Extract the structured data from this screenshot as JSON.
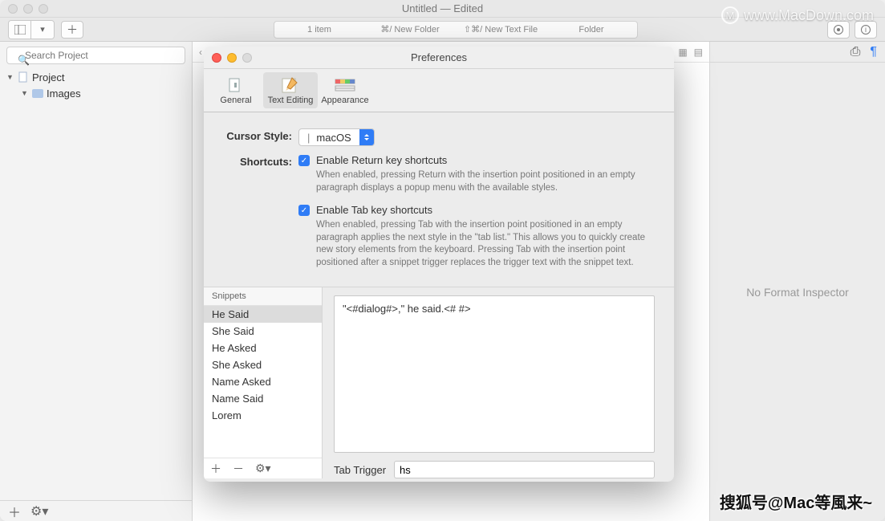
{
  "window": {
    "title": "Untitled — Edited",
    "infobar": {
      "items": "1 item",
      "newFolder": "⌘/ New Folder",
      "newTextFile": "⇧⌘/ New Text File",
      "folder": "Folder"
    }
  },
  "search": {
    "placeholder": "Search Project"
  },
  "tree": {
    "root": "Project",
    "child": "Images"
  },
  "inspector": {
    "empty": "No Format Inspector"
  },
  "prefs": {
    "title": "Preferences",
    "tabs": {
      "general": "General",
      "text": "Text Editing",
      "appearance": "Appearance"
    },
    "cursor": {
      "label": "Cursor Style:",
      "value": "macOS"
    },
    "shortcuts": {
      "label": "Shortcuts:",
      "return_label": "Enable Return key shortcuts",
      "return_help": "When enabled, pressing Return with the insertion point positioned in an empty paragraph displays a popup menu with the available styles.",
      "tab_label": "Enable Tab key shortcuts",
      "tab_help": "When enabled, pressing Tab with the insertion point positioned in an empty paragraph applies the next style in the \"tab list.\" This allows you to quickly create new story elements from the keyboard. Pressing Tab with the insertion point positioned after a snippet trigger replaces the trigger text with the snippet text."
    },
    "snippets": {
      "header": "Snippets",
      "items": [
        "He Said",
        "She Said",
        "He Asked",
        "She Asked",
        "Name Asked",
        "Name Said",
        "Lorem"
      ],
      "text": "\"<#dialog#>,\" he said.<# #>",
      "trigger_label": "Tab Trigger",
      "trigger_value": "hs"
    }
  },
  "watermark": {
    "top": "www.MacDown.com",
    "bottom": "搜狐号@Mac等風来~"
  }
}
